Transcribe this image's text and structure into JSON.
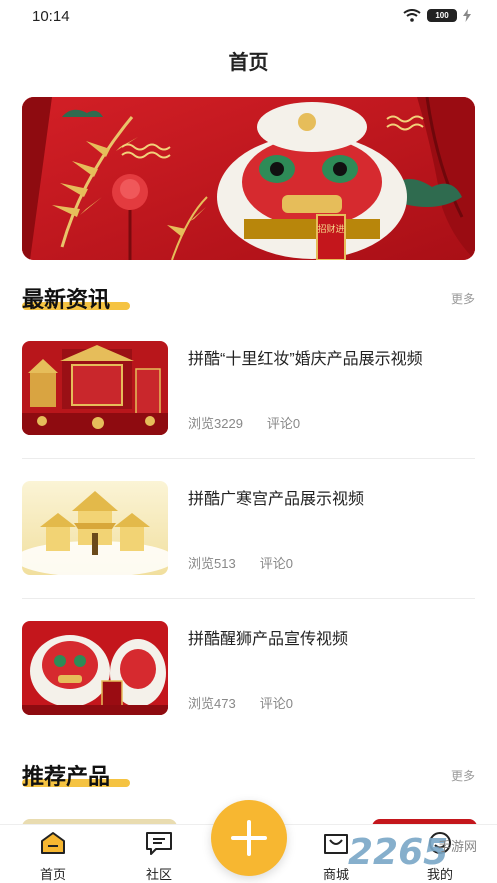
{
  "status_bar": {
    "time": "10:14",
    "battery": "100"
  },
  "header": {
    "title": "首页"
  },
  "banner": {
    "caption": "招财进"
  },
  "news_section": {
    "title": "最新资讯",
    "more": "更多",
    "items": [
      {
        "title": "拼酷“十里红妆”婚庆产品展示视频",
        "views": "浏览3229",
        "comments": "评论0"
      },
      {
        "title": "拼酷广寒宫产品展示视频",
        "views": "浏览513",
        "comments": "评论0"
      },
      {
        "title": "拼酷醒狮产品宣传视频",
        "views": "浏览473",
        "comments": "评论0"
      }
    ]
  },
  "product_section": {
    "title": "推荐产品",
    "more": "更多"
  },
  "tabbar": {
    "home": "首页",
    "community": "社区",
    "mall": "商城",
    "mine": "我的"
  },
  "watermark": {
    "brand": "2265",
    "sub": "手游网"
  },
  "colors": {
    "accent": "#f7b731",
    "banner_red": "#c4161c",
    "underline": "#f5c342"
  }
}
